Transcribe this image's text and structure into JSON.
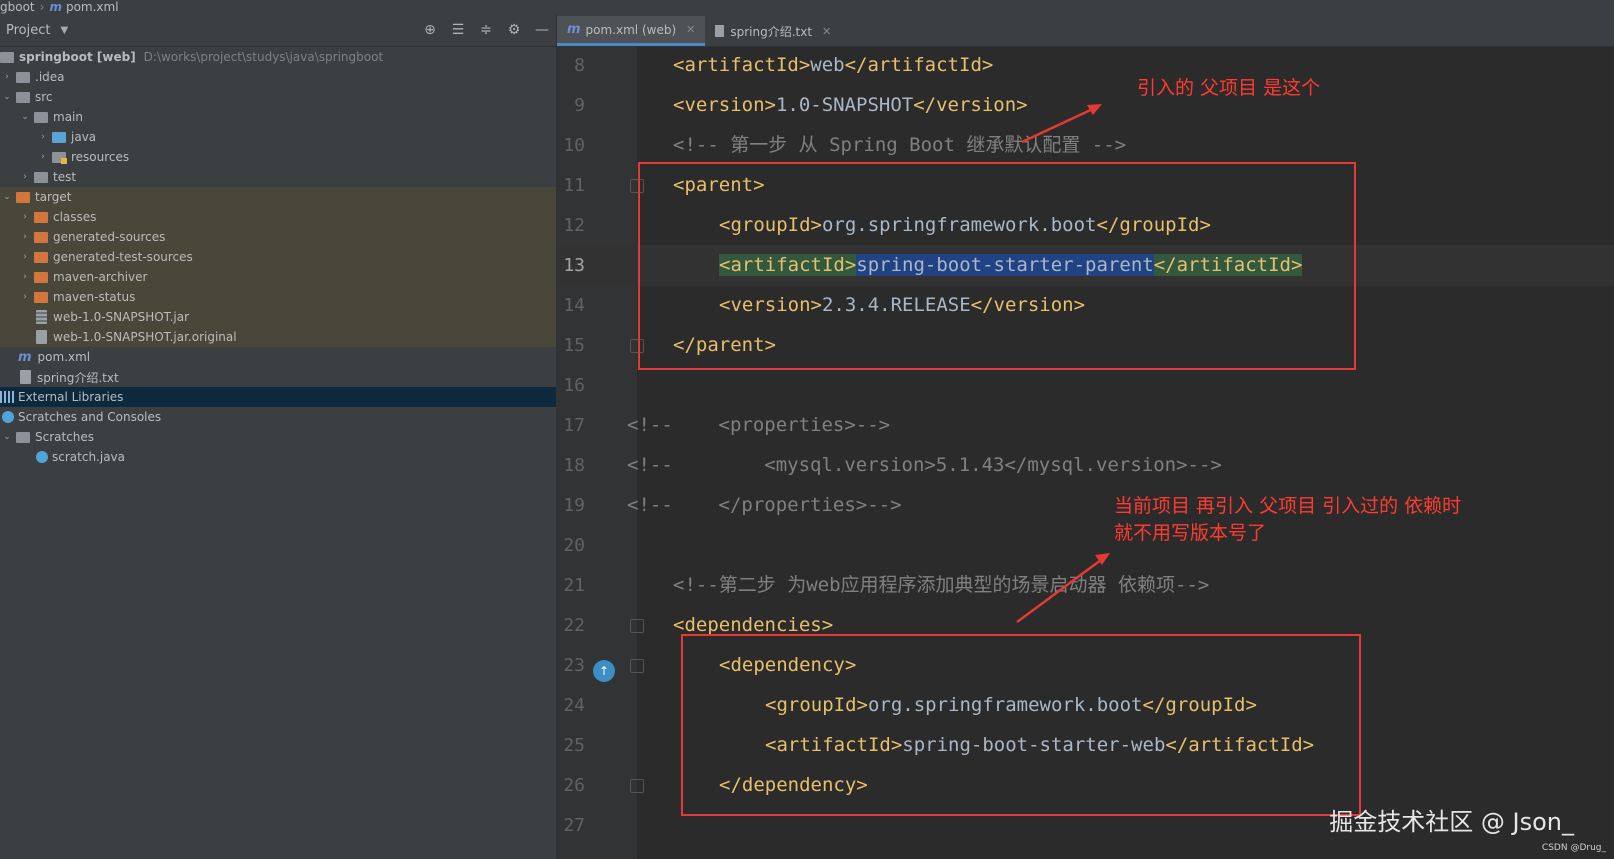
{
  "breadcrumb": {
    "root": "gboot",
    "file": "pom.xml"
  },
  "project_panel": {
    "title": "Project",
    "tools": [
      "locate-icon",
      "expand-all-icon",
      "collapse-all-icon",
      "gear-icon",
      "minimize-icon"
    ],
    "root_label": "springboot [web]",
    "root_path": "D:\\works\\project\\studys\\java\\springboot",
    "items": [
      {
        "label": ".idea"
      },
      {
        "label": "src"
      },
      {
        "label": "main"
      },
      {
        "label": "java"
      },
      {
        "label": "resources"
      },
      {
        "label": "test"
      },
      {
        "label": "target"
      },
      {
        "label": "classes"
      },
      {
        "label": "generated-sources"
      },
      {
        "label": "generated-test-sources"
      },
      {
        "label": "maven-archiver"
      },
      {
        "label": "maven-status"
      },
      {
        "label": "web-1.0-SNAPSHOT.jar"
      },
      {
        "label": "web-1.0-SNAPSHOT.jar.original"
      },
      {
        "label": "pom.xml"
      },
      {
        "label": "spring介绍.txt"
      },
      {
        "label": "External Libraries"
      },
      {
        "label": "Scratches and Consoles"
      },
      {
        "label": "Scratches"
      },
      {
        "label": "scratch.java"
      }
    ]
  },
  "tabs": [
    {
      "label": "pom.xml (web)",
      "active": true
    },
    {
      "label": "spring介绍.txt",
      "active": false
    }
  ],
  "code_lines": [
    {
      "n": "8",
      "parts": [
        [
          "tag",
          "<artifactId>"
        ],
        [
          "txt",
          "web"
        ],
        [
          "tag",
          "</artifactId>"
        ]
      ]
    },
    {
      "n": "9",
      "parts": [
        [
          "tag",
          "<version>"
        ],
        [
          "txt",
          "1.0-SNAPSHOT"
        ],
        [
          "tag",
          "</version>"
        ]
      ]
    },
    {
      "n": "10",
      "parts": [
        [
          "cmt",
          "<!-- 第一步 从 Spring Boot 继承默认配置 -->"
        ]
      ]
    },
    {
      "n": "11",
      "parts": [
        [
          "tag",
          "<parent>"
        ]
      ]
    },
    {
      "n": "12",
      "parts": [
        [
          "tag",
          "<groupId>"
        ],
        [
          "txt",
          "org.springframework.boot"
        ],
        [
          "tag",
          "</groupId>"
        ]
      ]
    },
    {
      "n": "13",
      "parts": [
        [
          "tagbg",
          "<artifactId>"
        ],
        [
          "hl",
          "spring-boot-starter-parent"
        ],
        [
          "tagbg",
          "</artifactId>"
        ]
      ]
    },
    {
      "n": "14",
      "parts": [
        [
          "tag",
          "<version>"
        ],
        [
          "txt",
          "2.3.4.RELEASE"
        ],
        [
          "tag",
          "</version>"
        ]
      ]
    },
    {
      "n": "15",
      "parts": [
        [
          "tag",
          "</parent>"
        ]
      ]
    },
    {
      "n": "16",
      "parts": []
    },
    {
      "n": "17",
      "parts": [
        [
          "cmt",
          "<!--    <properties>-->"
        ]
      ]
    },
    {
      "n": "18",
      "parts": [
        [
          "cmt",
          "<!--        <mysql.version>5.1.43</mysql.version>-->"
        ]
      ]
    },
    {
      "n": "19",
      "parts": [
        [
          "cmt",
          "<!--    </properties>-->"
        ]
      ]
    },
    {
      "n": "20",
      "parts": []
    },
    {
      "n": "21",
      "parts": [
        [
          "cmt",
          "<!--第二步 为web应用程序添加典型的场景启动器 依赖项-->"
        ]
      ]
    },
    {
      "n": "22",
      "parts": [
        [
          "tag",
          "<dependencies>"
        ]
      ]
    },
    {
      "n": "23",
      "parts": [
        [
          "tag",
          "<dependency>"
        ]
      ]
    },
    {
      "n": "24",
      "parts": [
        [
          "tag",
          "<groupId>"
        ],
        [
          "txt",
          "org.springframework.boot"
        ],
        [
          "tag",
          "</groupId>"
        ]
      ]
    },
    {
      "n": "25",
      "parts": [
        [
          "tag",
          "<artifactId>"
        ],
        [
          "txt",
          "spring-boot-starter-web"
        ],
        [
          "tag",
          "</artifactId>"
        ]
      ]
    },
    {
      "n": "26",
      "parts": [
        [
          "tag",
          "</dependency>"
        ]
      ]
    },
    {
      "n": "27",
      "parts": []
    }
  ],
  "annotations": {
    "top": "引入的 父项目 是这个",
    "bottom_line1": "当前项目 再引入 父项目 引入过的 依赖时",
    "bottom_line2": "就不用写版本号了"
  },
  "watermark": "掘金技术社区 @ Json_",
  "watermark_small": "CSDN @Drug_",
  "colors": {
    "annotation": "#ff3b30",
    "tag": "#e8bf6a",
    "comment": "#808080",
    "selection": "#214283"
  }
}
